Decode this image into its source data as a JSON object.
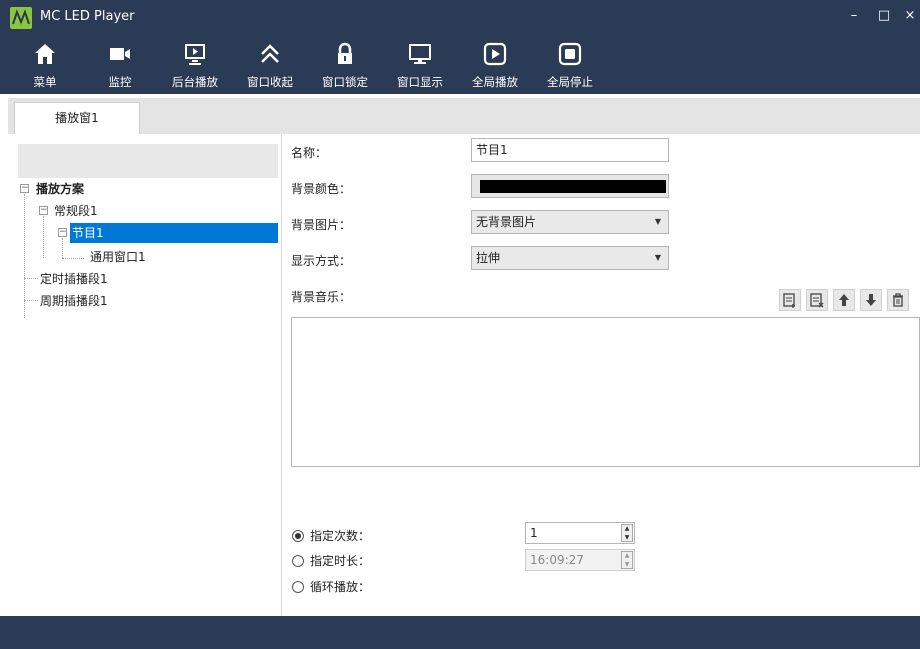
{
  "window": {
    "title": "MC LED Player",
    "min": "–",
    "max": "□",
    "close": "×"
  },
  "toolbar": [
    {
      "label": "菜单",
      "icon": "home-icon"
    },
    {
      "label": "监控",
      "icon": "camera-icon"
    },
    {
      "label": "后台播放",
      "icon": "monitor-play-icon"
    },
    {
      "label": "窗口收起",
      "icon": "chevrons-up-icon"
    },
    {
      "label": "窗口锁定",
      "icon": "lock-icon"
    },
    {
      "label": "窗口显示",
      "icon": "monitor-icon"
    },
    {
      "label": "全局播放",
      "icon": "play-icon"
    },
    {
      "label": "全局停止",
      "icon": "stop-icon"
    }
  ],
  "tabs": [
    {
      "label": "播放窗1"
    }
  ],
  "tree": {
    "root": "播放方案",
    "normal_segment": "常规段1",
    "program": "节目1",
    "window": "通用窗口1",
    "timed_segment": "定时插播段1",
    "periodic_segment": "周期插播段1"
  },
  "form": {
    "name_label": "名称：",
    "name_value": "节目1",
    "bgcolor_label": "背景颜色：",
    "bgcolor_value": "#000000",
    "bgimage_label": "背景图片：",
    "bgimage_value": "无背景图片",
    "display_label": "显示方式：",
    "display_value": "拉伸",
    "music_label": "背景音乐："
  },
  "music_buttons": [
    "add-music-icon",
    "remove-music-icon",
    "move-up-icon",
    "move-down-icon",
    "delete-icon"
  ],
  "playback": {
    "count_label": "指定次数：",
    "count_value": "1",
    "duration_label": "指定时长：",
    "duration_value": "16:09:27",
    "loop_label": "循环播放："
  },
  "colors": {
    "chrome": "#2b3a55",
    "selection": "#0078d7",
    "logo": "#8cc63f"
  }
}
